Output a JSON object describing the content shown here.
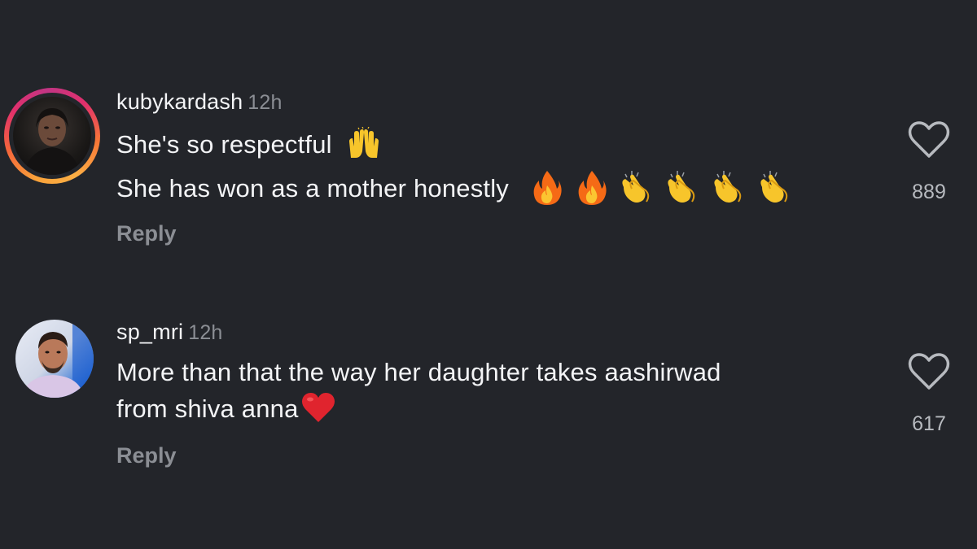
{
  "comments": [
    {
      "username": "kubykardash",
      "time": "12h",
      "lines": [
        "She's so respectful",
        "She has won as a mother honestly"
      ],
      "emoji_line1": [
        "raising-hands-emoji"
      ],
      "emoji_line2": [
        "fire-emoji",
        "fire-emoji",
        "clapping-hands-emoji",
        "clapping-hands-emoji",
        "clapping-hands-emoji",
        "clapping-hands-emoji"
      ],
      "likes": "889",
      "reply_label": "Reply",
      "has_story_ring": true
    },
    {
      "username": "sp_mri",
      "time": "12h",
      "lines": [
        "More than that the way her daughter takes aashirwad",
        "from shiva anna"
      ],
      "emoji_line2": [
        "red-heart-emoji"
      ],
      "likes": "617",
      "reply_label": "Reply",
      "has_story_ring": false
    }
  ],
  "colors": {
    "background": "#23252a",
    "text": "#f3f4f6",
    "muted": "#8b8e94"
  }
}
